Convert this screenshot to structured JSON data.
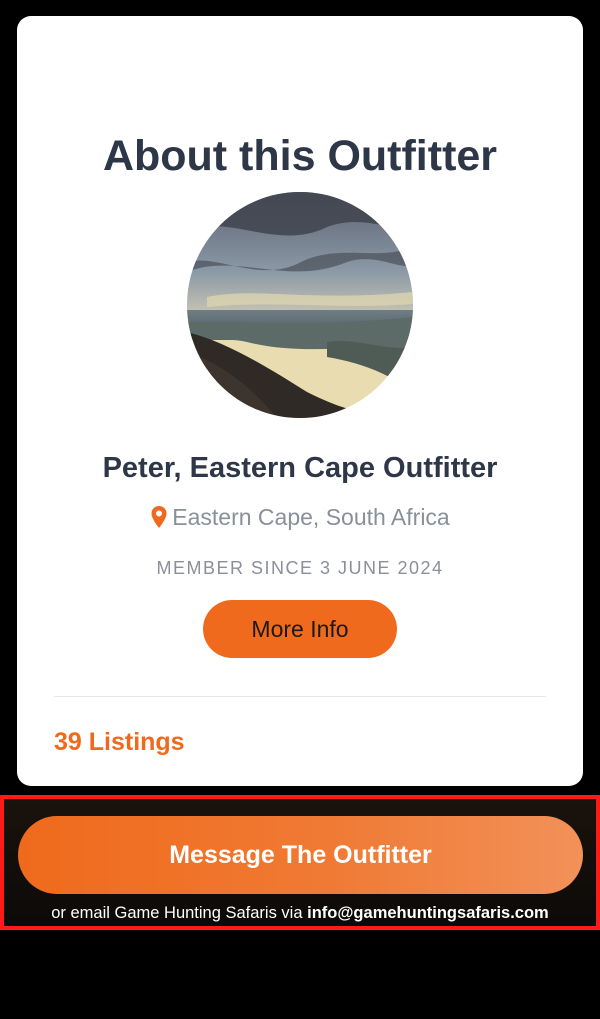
{
  "card": {
    "title": "About this Outfitter",
    "outfitter_name": "Peter, Eastern Cape Outfitter",
    "location": "Eastern Cape, South Africa",
    "member_since": "MEMBER SINCE 3 JUNE 2024",
    "more_info_label": "More Info",
    "listings_label": "39 Listings"
  },
  "cta": {
    "button_label": "Message The Outfitter",
    "note_prefix": "or email Game Hunting Safaris via ",
    "email": "info@gamehuntingsafaris.com"
  },
  "icons": {
    "location": "map-pin-icon"
  },
  "colors": {
    "accent": "#f06a1e",
    "heading": "#2d3748",
    "muted": "#8a9099",
    "highlight_border": "#ff1a1a"
  }
}
